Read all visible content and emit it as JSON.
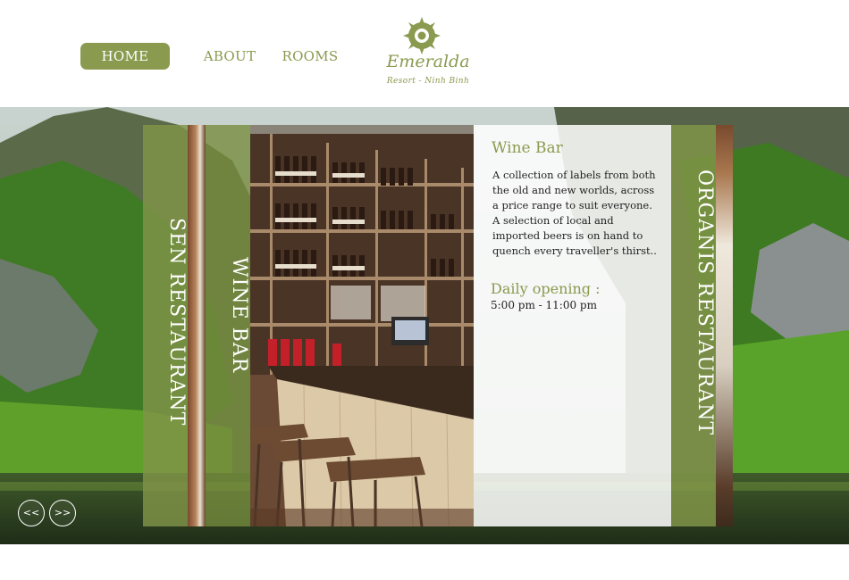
{
  "nav": {
    "home": "HOME",
    "about": "ABOUT",
    "rooms": "ROOMS"
  },
  "logo": {
    "name": "Emeralda",
    "tagline": "Resort - Ninh Binh"
  },
  "slider": {
    "panels": {
      "sen": "SEN RESTAURANT",
      "wine": "WINE BAR",
      "organis": "ORGANIS RESTAURANT"
    },
    "active": {
      "title": "Wine Bar",
      "description": "A collection of labels from both the old and new worlds, across a price range to suit everyone. A selection of local and imported beers is on hand to quench every traveller's thirst..",
      "hours_label": "Daily opening :",
      "hours": "5:00 pm - 11:00 pm"
    },
    "prev": "<<",
    "next": ">>"
  },
  "colors": {
    "accent": "#8a9a4f",
    "nav_active_bg": "#8a9a4f",
    "text": "#222222"
  }
}
